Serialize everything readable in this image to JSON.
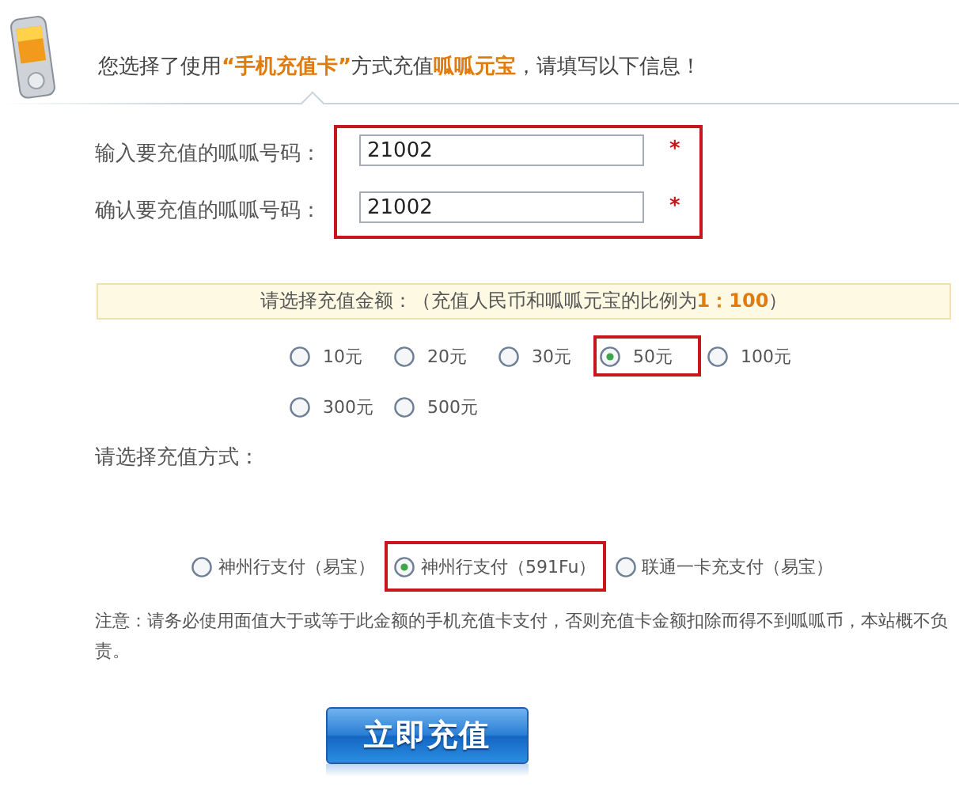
{
  "header": {
    "message": "您选择了使用**“手机充值卡”**方式充值**呱呱元宝**，请填写以下信息！"
  },
  "fields": [
    {
      "label": "输入要充值的呱呱号码：",
      "value": "21002",
      "required_mark": "*"
    },
    {
      "label": "确认要充值的呱呱号码：",
      "value": "21002",
      "required_mark": "*"
    }
  ],
  "amount_notice": "请选择充值金额：（充值人民币和呱呱元宝的比例为**1：100**）",
  "amounts": [
    {
      "label": "10元",
      "selected": false
    },
    {
      "label": "20元",
      "selected": false
    },
    {
      "label": "30元",
      "selected": false
    },
    {
      "label": "50元",
      "selected": true
    },
    {
      "label": "100元",
      "selected": false
    },
    {
      "label": "300元",
      "selected": false
    },
    {
      "label": "500元",
      "selected": false
    }
  ],
  "method_title": "请选择充值方式：",
  "methods": [
    {
      "label": "神州行支付（易宝）",
      "selected": false
    },
    {
      "label": "神州行支付（591Fu）",
      "selected": true
    },
    {
      "label": "联通一卡充支付（易宝）",
      "selected": false
    }
  ],
  "note": "注意：请务必使用面值大于或等于此金额的手机充值卡支付，否则充值卡金额扣除而得不到呱呱币，本站概不负责。",
  "submit_button": "立即充值"
}
